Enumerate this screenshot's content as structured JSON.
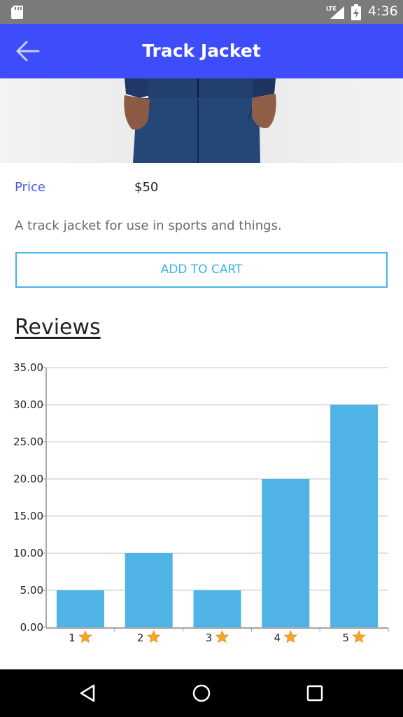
{
  "status_bar": {
    "time": "4:36",
    "network": "LTE",
    "icons": [
      "sd-card-icon",
      "lte-signal-icon",
      "battery-charging-icon"
    ]
  },
  "app_bar": {
    "title": "Track Jacket",
    "back_icon": "arrow-left-icon",
    "background": "#3d4dfa"
  },
  "product": {
    "price_label": "Price",
    "price_value": "$50",
    "description": "A track jacket for use in sports and things.",
    "add_to_cart_label": "ADD TO CART"
  },
  "reviews": {
    "heading": "Reviews"
  },
  "chart_data": {
    "type": "bar",
    "categories": [
      "1",
      "2",
      "3",
      "4",
      "5"
    ],
    "category_icon": "star-icon",
    "values": [
      5,
      10,
      5,
      20,
      30
    ],
    "ylim": [
      0,
      35
    ],
    "yticks": [
      "0.00",
      "5.00",
      "10.00",
      "15.00",
      "20.00",
      "25.00",
      "30.00",
      "35.00"
    ],
    "title": "",
    "xlabel": "",
    "ylabel": "",
    "grid": true,
    "bar_color": "#4fb3e5"
  },
  "colors": {
    "accent": "#3d4dfa",
    "price_label": "#4a5ee8",
    "button": "#45b3ec",
    "star": "#f5a623"
  },
  "nav_bar": {
    "icons": [
      "nav-back-icon",
      "nav-home-icon",
      "nav-recents-icon"
    ]
  }
}
